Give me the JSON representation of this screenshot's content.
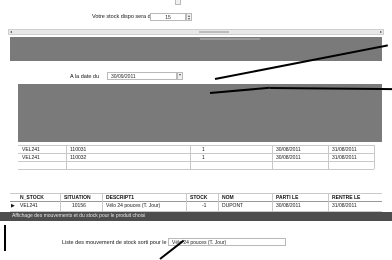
{
  "stock_form": {
    "dispo_label": "Votre stock dispo sera de",
    "dispo_value": "15"
  },
  "date_form": {
    "date_label": "A la date du",
    "date_value": "30/09/2011"
  },
  "upper_table": {
    "rows": [
      {
        "code": "VEL241",
        "num": "110031",
        "qty": "1",
        "date1": "30/08/2011",
        "date2": "31/08/2011"
      },
      {
        "code": "VEL241",
        "num": "110032",
        "qty": "1",
        "date1": "30/08/2011",
        "date2": "31/08/2011"
      }
    ]
  },
  "lower_table": {
    "headers": [
      "N_STOCK",
      "SITUATION",
      "DESCRIPT1",
      "STOCK",
      "NOM",
      "PARTI LE",
      "RENTRE LE"
    ],
    "rows": [
      {
        "n_stock": "VEL241",
        "situation": "10156",
        "descript": "Vélo 24 pouces (T. Jour)",
        "stock": "-1",
        "nom": "DUPONT",
        "parti": "30/08/2011",
        "rentre": "31/08/2011"
      }
    ],
    "tooltip": "Affichage des mouvements et du stock pour le produit choisi"
  },
  "footer": {
    "list_label": "Liste des mouvement de stock sorti pour le",
    "list_value": "Vélo 24 pouces (T. Jour)"
  }
}
